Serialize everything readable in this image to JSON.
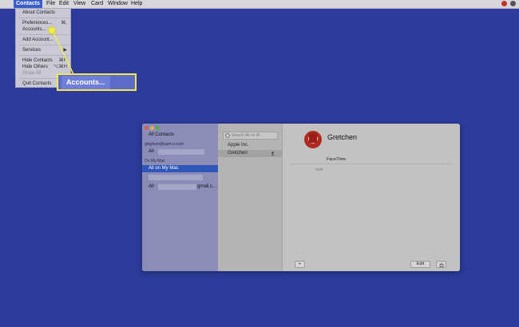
{
  "menubar": {
    "apple_icon": "apple-icon",
    "items": [
      "Contacts",
      "File",
      "Edit",
      "View",
      "Card",
      "Window",
      "Help"
    ],
    "active_item": "Contacts"
  },
  "dropdown": {
    "about": "About Contacts",
    "preferences": "Preferences...",
    "preferences_shortcut": "⌘,",
    "accounts": "Accounts...",
    "add_account": "Add Account...",
    "services": "Services",
    "services_arrow": "▶",
    "hide_contacts": "Hide Contacts",
    "hide_contacts_shortcut": "⌘H",
    "hide_others": "Hide Others",
    "hide_others_shortcut": "⌥⌘H",
    "show_all": "Show All",
    "quit": "Quit Contacts"
  },
  "callout": {
    "label": "Accounts...",
    "color": "#f2e94e"
  },
  "window": {
    "sidebar": {
      "all_contacts": "All Contacts",
      "account_email": "gbigham@sam.rr.com",
      "account_all": "All",
      "on_my_mac_header": "On My Mac",
      "all_on_my_mac": "All on My Mac",
      "gmail_all_prefix": "All",
      "gmail_suffix": "gmail.c..."
    },
    "list": {
      "search_placeholder": "Search All on M...",
      "rows": [
        "Apple Inc.",
        "Gretchen"
      ]
    },
    "detail": {
      "name": "Gretchen",
      "facetime": "FaceTime",
      "note_label": "note",
      "add_button": "+",
      "edit_button": "Edit",
      "share_icon": "share-icon"
    }
  },
  "colors": {
    "desktop": "#2d3b9c",
    "selection": "#2f56b8",
    "highlight": "#f2e94e"
  }
}
